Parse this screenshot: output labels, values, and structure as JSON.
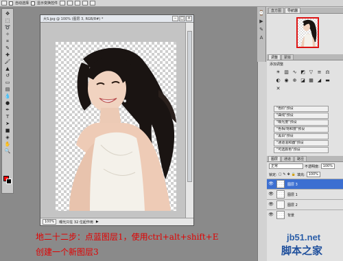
{
  "colors": {
    "caption": "#e10000",
    "foreground_swatch": "#ee0000",
    "background_swatch": "#000000",
    "selected_layer": "#3c6fd1",
    "watermark": "#1f4f9c"
  },
  "options_bar": {
    "auto_select_label": "自动选择",
    "show_transform_label": "显示变换控件"
  },
  "tools": [
    "move-tool",
    "marquee-tool",
    "lasso-tool",
    "magic-wand-tool",
    "crop-tool",
    "eyedropper-tool",
    "healing-brush-tool",
    "brush-tool",
    "clone-stamp-tool",
    "history-brush-tool",
    "eraser-tool",
    "gradient-tool",
    "blur-tool",
    "dodge-tool",
    "pen-tool",
    "type-tool",
    "path-selection-tool",
    "shape-tool",
    "3d-tool",
    "hand-tool",
    "zoom-tool"
  ],
  "document": {
    "title": "大S.jpg @ 100% (图层 3, RGB/8#) *",
    "zoom": "100%",
    "status_info": "曝光只在 32 位起作用"
  },
  "panels": {
    "navigator_tabs": [
      "直方图",
      "导航器"
    ],
    "adjust_tabs": [
      "调整",
      "蒙版"
    ],
    "adjust_title": "添加调整",
    "adjust_presets": [
      "\"色阶\"预设",
      "\"曲线\"预设",
      "\"曝光度\"预设",
      "\"色相/饱和度\"预设",
      "\"黑白\"预设",
      "\"通道混和器\"预设",
      "\"可选颜色\"预设"
    ],
    "layers_tabs": [
      "图层",
      "通道",
      "路径"
    ],
    "blend_mode": "正常",
    "opacity_label": "不透明度:",
    "opacity": "100%",
    "lock_label": "锁定:",
    "fill_label": "填充:",
    "fill": "100%",
    "layers": [
      {
        "name": "图层 3",
        "selected": true
      },
      {
        "name": "图层 1",
        "selected": false
      },
      {
        "name": "图层 2",
        "selected": false
      },
      {
        "name": "背景",
        "selected": false
      }
    ]
  },
  "caption": {
    "line1": "地二十二步：点蓝图层1，使用ctrl+alt+shift+E",
    "line2": "创建一个新图层3"
  },
  "watermark": {
    "url": "jb51.net",
    "site": "脚本之家"
  }
}
